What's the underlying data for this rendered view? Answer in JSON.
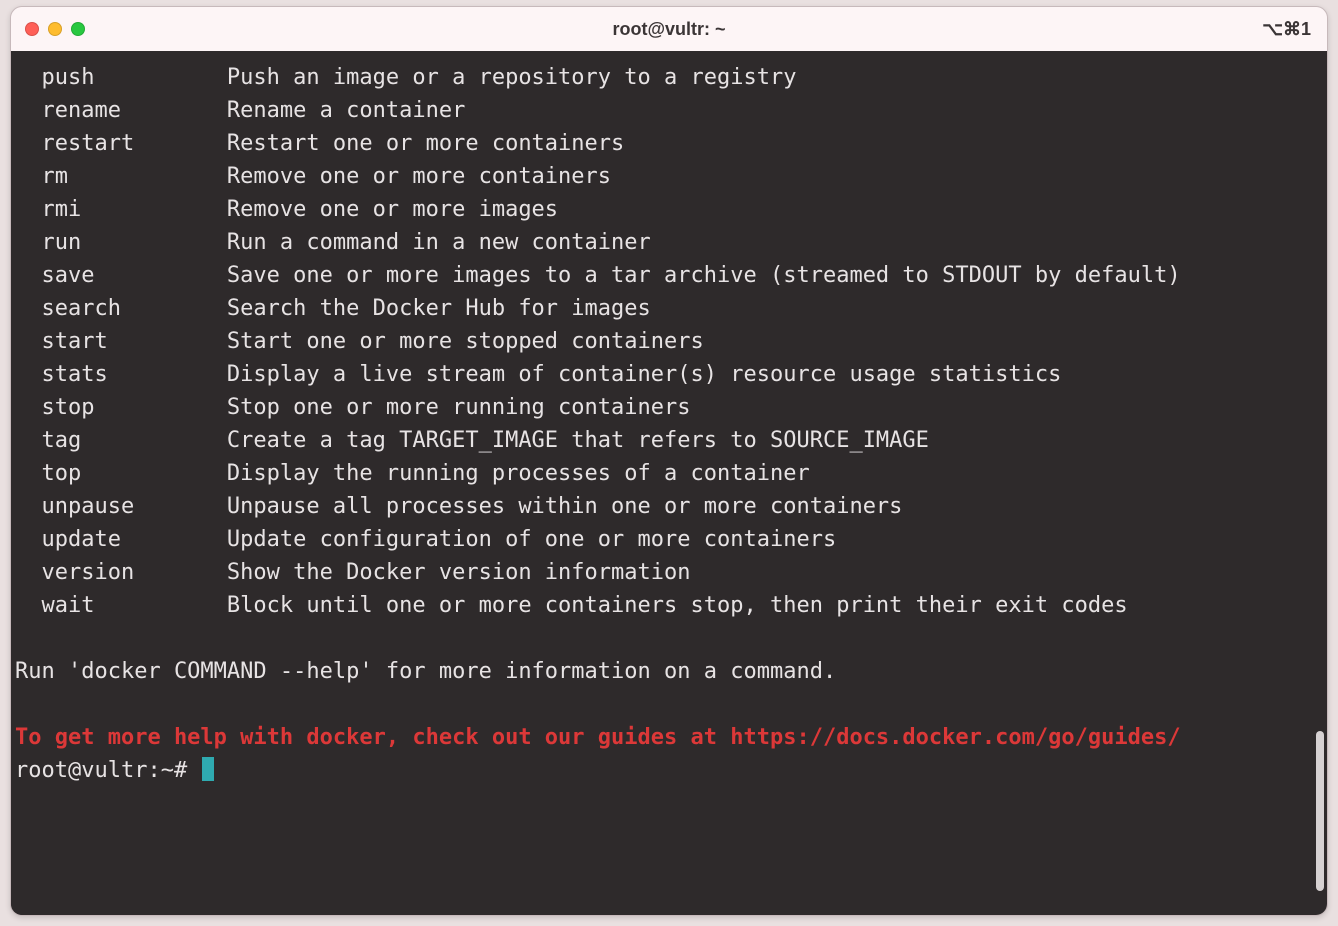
{
  "window": {
    "title": "root@vultr: ~",
    "shortcut": "⌥⌘1"
  },
  "terminal": {
    "commands": [
      {
        "name": "push",
        "desc": "Push an image or a repository to a registry"
      },
      {
        "name": "rename",
        "desc": "Rename a container"
      },
      {
        "name": "restart",
        "desc": "Restart one or more containers"
      },
      {
        "name": "rm",
        "desc": "Remove one or more containers"
      },
      {
        "name": "rmi",
        "desc": "Remove one or more images"
      },
      {
        "name": "run",
        "desc": "Run a command in a new container"
      },
      {
        "name": "save",
        "desc": "Save one or more images to a tar archive (streamed to STDOUT by default)"
      },
      {
        "name": "search",
        "desc": "Search the Docker Hub for images"
      },
      {
        "name": "start",
        "desc": "Start one or more stopped containers"
      },
      {
        "name": "stats",
        "desc": "Display a live stream of container(s) resource usage statistics"
      },
      {
        "name": "stop",
        "desc": "Stop one or more running containers"
      },
      {
        "name": "tag",
        "desc": "Create a tag TARGET_IMAGE that refers to SOURCE_IMAGE"
      },
      {
        "name": "top",
        "desc": "Display the running processes of a container"
      },
      {
        "name": "unpause",
        "desc": "Unpause all processes within one or more containers"
      },
      {
        "name": "update",
        "desc": "Update configuration of one or more containers"
      },
      {
        "name": "version",
        "desc": "Show the Docker version information"
      },
      {
        "name": "wait",
        "desc": "Block until one or more containers stop, then print their exit codes"
      }
    ],
    "help_line": "Run 'docker COMMAND --help' for more information on a command.",
    "guides_line": "To get more help with docker, check out our guides at https://docs.docker.com/go/guides/",
    "prompt": "root@vultr:~# "
  }
}
